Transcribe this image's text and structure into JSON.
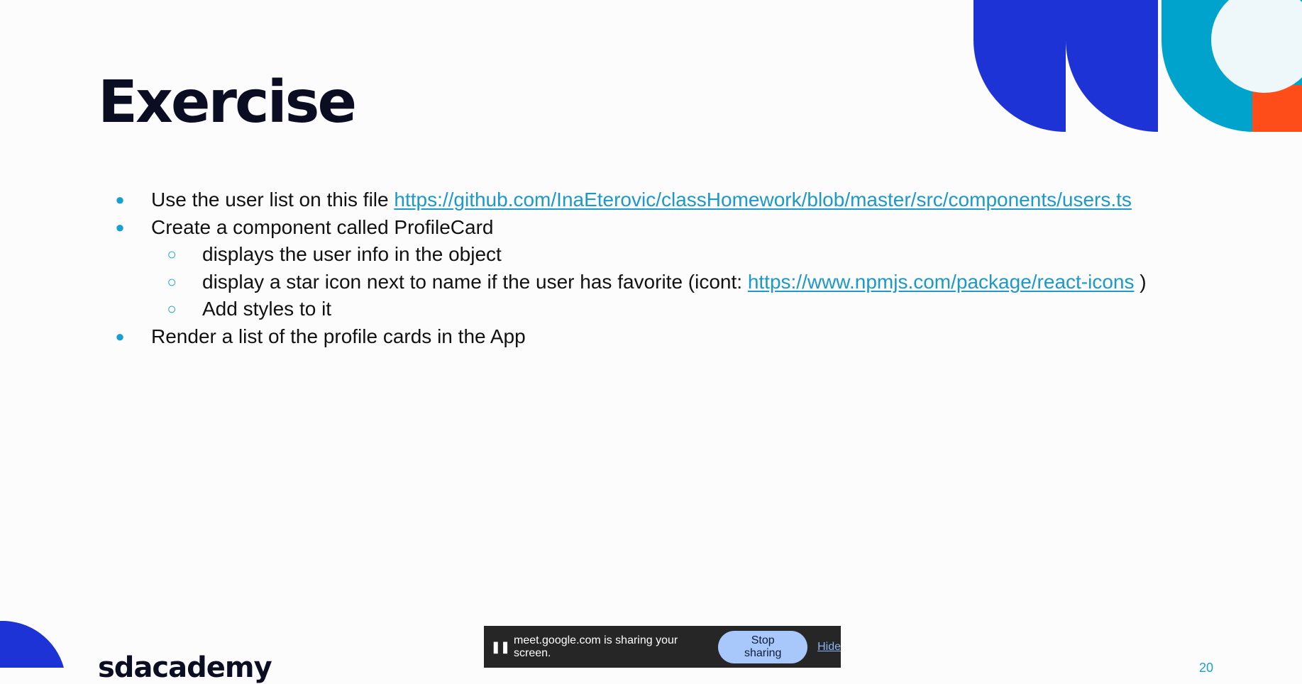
{
  "slide": {
    "title": "Exercise",
    "bullets": {
      "item1_text": "Use the user list on this file ",
      "item1_link": "https://github.com/InaEterovic/classHomework/blob/master/src/components/users.ts",
      "item2_text": "Create a component called ProfileCard",
      "sub1_text": "displays the user info in the object",
      "sub2_text": "display a star icon next to name if the user has favorite (icont: ",
      "sub2_link": "https://www.npmjs.com/package/react-icons",
      "sub2_tail": " )",
      "sub3_text": "Add styles to it",
      "item3_text": "Render a list of the profile cards in the App"
    },
    "bullet_symbol": "●",
    "sub_bullet_symbol": "○",
    "logo_text": "sdacademy",
    "page_number": "20"
  },
  "share_bar": {
    "pause_icon": "pause-icon",
    "message": "meet.google.com is sharing your screen.",
    "stop_label": "Stop sharing",
    "hide_label": "Hide"
  },
  "colors": {
    "blue": "#1d33d6",
    "teal": "#00a3cc",
    "orange": "#ff4d1a",
    "link": "#1c98c9",
    "title": "#0b0d22"
  }
}
